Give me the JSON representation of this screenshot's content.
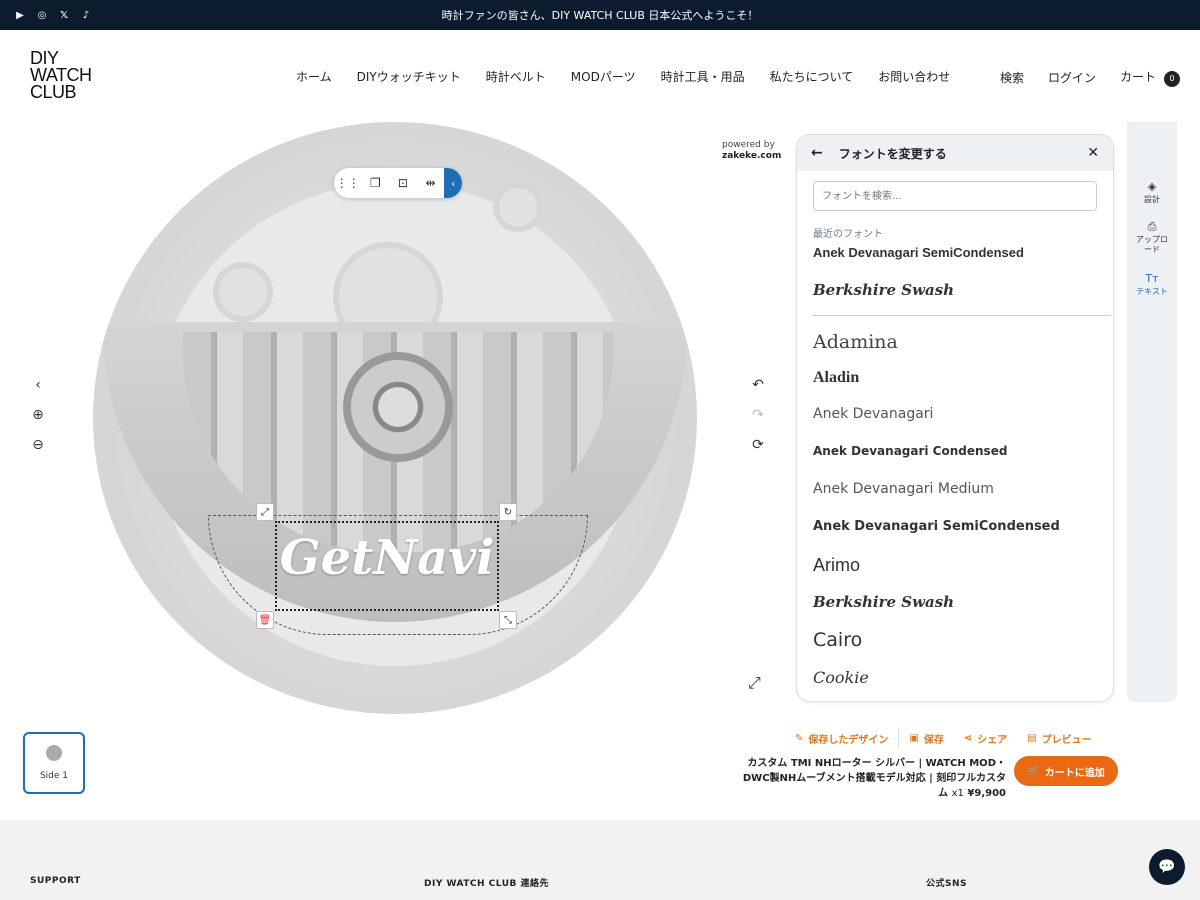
{
  "announcement": "時計ファンの皆さん、DIY WATCH CLUB 日本公式へようこそ！",
  "social": [
    "youtube-icon",
    "instagram-icon",
    "x-icon",
    "tiktok-icon"
  ],
  "logo": [
    "DIY",
    "WATCH",
    "CLUB"
  ],
  "nav": [
    "ホーム",
    "DIYウォッチキット",
    "時計ベルト",
    "MODパーツ",
    "時計工具・用品",
    "私たちについて",
    "お問い合わせ"
  ],
  "header_right": {
    "search": "検索",
    "login": "ログイン",
    "cart": "カート",
    "cart_count": "0"
  },
  "powered_by": {
    "line1": "powered by",
    "line2": "zakeke.com"
  },
  "design_text": "GetNavi",
  "font_panel": {
    "title": "フォントを変更する",
    "search_placeholder": "フォントを検索...",
    "recent_label": "最近のフォント",
    "recent": [
      "Anek Devanagari SemiCondensed",
      "Berkshire Swash"
    ],
    "fonts": [
      "Adamina",
      "Aladin",
      "Anek Devanagari",
      "Anek Devanagari Condensed",
      "Anek Devanagari Medium",
      "Anek Devanagari SemiCondensed",
      "Arimo",
      "Berkshire Swash",
      "Cairo",
      "Cookie"
    ]
  },
  "rail": [
    {
      "label": "設計",
      "icon": "layers-icon"
    },
    {
      "label": "アップロード",
      "icon": "upload-icon"
    },
    {
      "label": "テキスト",
      "icon": "text-icon"
    }
  ],
  "side_label": "Side 1",
  "actions": {
    "saved": "保存したデザイン",
    "save": "保存",
    "share": "シェア",
    "preview": "プレビュー"
  },
  "product": {
    "title": "カスタム TMI NHローター シルバー | WATCH MOD・DWC製NHムーブメント搭載モデル対応 | 刻印フルカスタム",
    "qty": "x1",
    "price": "¥9,900"
  },
  "add_to_cart": "カートに追加",
  "footer": {
    "support": "SUPPORT",
    "contact": "DIY WATCH CLUB 連絡先",
    "sns": "公式SNS"
  },
  "colors": {
    "accent": "#ea6a14",
    "brand": "#1e6eb5",
    "topbar": "#0d1b2e"
  }
}
